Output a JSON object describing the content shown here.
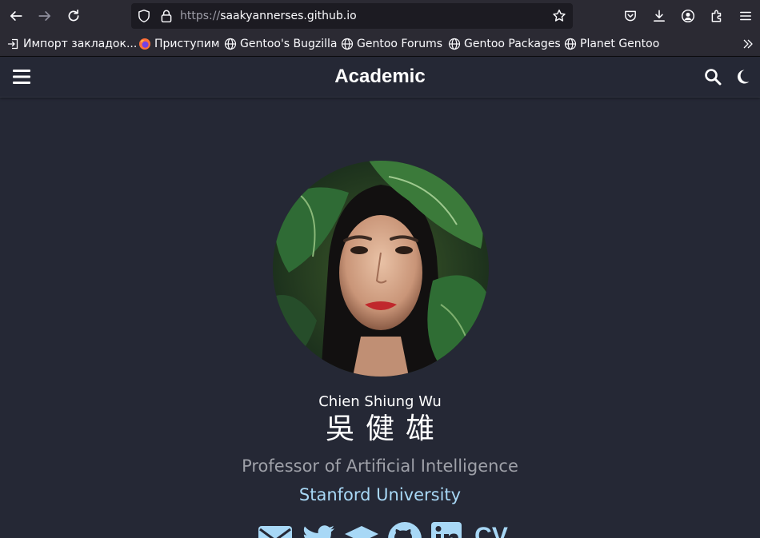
{
  "browser": {
    "url_scheme": "https://",
    "url_host": "saakyannerses.github.io",
    "bookmarks": [
      {
        "label": "Импорт закладок..."
      },
      {
        "label": "Приступим"
      },
      {
        "label": "Gentoo's Bugzilla"
      },
      {
        "label": "Gentoo Forums"
      },
      {
        "label": "Gentoo Packages"
      },
      {
        "label": "Planet Gentoo"
      }
    ]
  },
  "site": {
    "brand": "Academic",
    "theme_background": "#252835",
    "link_color": "#a8d8f6"
  },
  "profile": {
    "name": "Chien Shiung Wu",
    "name_cn": "吳健雄",
    "role": "Professor of Artificial Intelligence",
    "organization": "Stanford University",
    "social": [
      {
        "icon": "envelope-icon"
      },
      {
        "icon": "twitter-icon"
      },
      {
        "icon": "graduation-cap-icon"
      },
      {
        "icon": "github-icon"
      },
      {
        "icon": "linkedin-icon"
      },
      {
        "icon": "cv-icon",
        "label": "CV"
      }
    ]
  }
}
